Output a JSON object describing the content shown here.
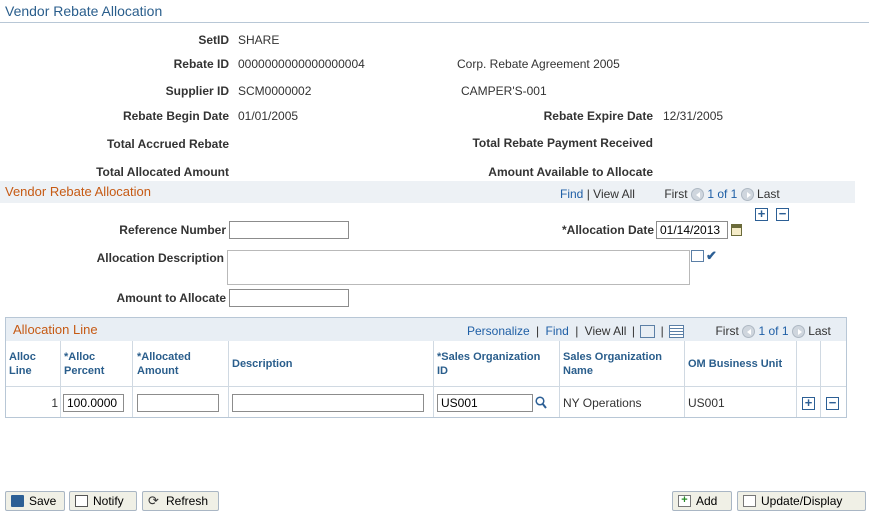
{
  "page": {
    "title": "Vendor Rebate Allocation"
  },
  "header": {
    "setid_label": "SetID",
    "setid": "SHARE",
    "rebate_id_label": "Rebate ID",
    "rebate_id": "0000000000000000004",
    "rebate_desc": "Corp. Rebate Agreement 2005",
    "supplier_id_label": "Supplier ID",
    "supplier_id": "SCM0000002",
    "supplier_name": "CAMPER'S-001",
    "begin_label": "Rebate Begin Date",
    "begin": "01/01/2005",
    "expire_label": "Rebate Expire Date",
    "expire": "12/31/2005",
    "accrued_label": "Total Accrued Rebate",
    "payment_label": "Total Rebate Payment Received",
    "allocated_label": "Total Allocated Amount",
    "available_label": "Amount Available to Allocate"
  },
  "section": {
    "title": "Vendor Rebate Allocation",
    "find": "Find",
    "sep": "|",
    "view_all": "View All",
    "first": "First",
    "range": "1 of 1",
    "last": "Last"
  },
  "form": {
    "ref_label": "Reference Number",
    "ref_value": "",
    "alloc_date_label": "*Allocation Date",
    "alloc_date": "01/14/2013",
    "desc_label": "Allocation Description",
    "amount_label": "Amount to Allocate",
    "amount_value": ""
  },
  "grid": {
    "title": "Allocation Line",
    "personalize": "Personalize",
    "find": "Find",
    "view_all": "View All",
    "first": "First",
    "range": "1 of 1",
    "last": "Last",
    "columns": {
      "line1": "Alloc",
      "line2": "Line",
      "pct1": "*Alloc",
      "pct2": "Percent",
      "amt1": "*Allocated",
      "amt2": "Amount",
      "desc": "Description",
      "org1": "*Sales Organization",
      "org2": "ID",
      "name1": "Sales Organization",
      "name2": "Name",
      "unit": "OM Business Unit"
    },
    "rows": [
      {
        "line": "1",
        "percent": "100.0000",
        "amount": "",
        "description": "",
        "org_id": "US001",
        "org_name": "NY Operations",
        "unit": "US001"
      }
    ]
  },
  "buttons": {
    "save": "Save",
    "notify": "Notify",
    "refresh": "Refresh",
    "add": "Add",
    "update": "Update/Display"
  }
}
